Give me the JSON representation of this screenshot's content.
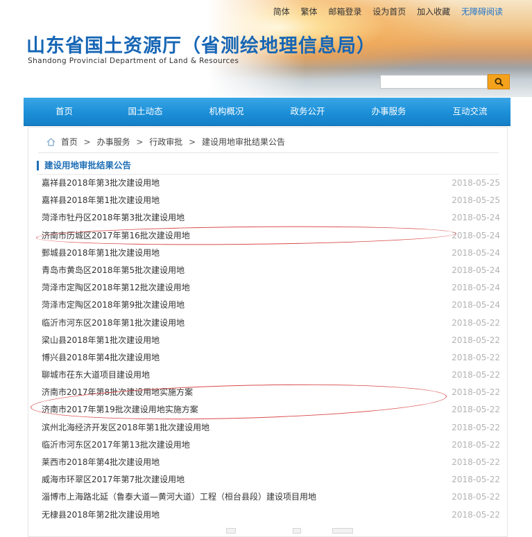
{
  "top_links": {
    "simplified": "简体",
    "traditional": "繁体",
    "mail_login": "邮箱登录",
    "set_homepage": "设为首页",
    "add_favorite": "加入收藏",
    "accessible_read": "无障碍阅读"
  },
  "site": {
    "title": "山东省国土资源厅（省测绘地理信息局）",
    "subtitle": "Shandong Provincial Department of Land & Resources"
  },
  "search": {
    "placeholder": ""
  },
  "nav": {
    "items": [
      {
        "label": "首页"
      },
      {
        "label": "国土动态"
      },
      {
        "label": "机构概况"
      },
      {
        "label": "政务公开"
      },
      {
        "label": "办事服务"
      },
      {
        "label": "互动交流"
      }
    ]
  },
  "breadcrumb": {
    "items": [
      {
        "label": "首页"
      },
      {
        "label": "办事服务"
      },
      {
        "label": "行政审批"
      },
      {
        "label": "建设用地审批结果公告"
      }
    ],
    "separator": ">"
  },
  "section_title": "建设用地审批结果公告",
  "list": [
    {
      "title": "嘉祥县2018年第3批次建设用地",
      "date": "2018-05-25"
    },
    {
      "title": "嘉祥县2018年第1批次建设用地",
      "date": "2018-05-25"
    },
    {
      "title": "菏泽市牡丹区2018年第3批次建设用地",
      "date": "2018-05-24"
    },
    {
      "title": "济南市历城区2017年第16批次建设用地",
      "date": "2018-05-24"
    },
    {
      "title": "鄄城县2018年第1批次建设用地",
      "date": "2018-05-24"
    },
    {
      "title": "青岛市黄岛区2018年第5批次建设用地",
      "date": "2018-05-24"
    },
    {
      "title": "菏泽市定陶区2018年第12批次建设用地",
      "date": "2018-05-24"
    },
    {
      "title": "菏泽市定陶区2018年第9批次建设用地",
      "date": "2018-05-24"
    },
    {
      "title": "临沂市河东区2018年第1批次建设用地",
      "date": "2018-05-22"
    },
    {
      "title": "梁山县2018年第1批次建设用地",
      "date": "2018-05-22"
    },
    {
      "title": "博兴县2018年第4批次建设用地",
      "date": "2018-05-22"
    },
    {
      "title": "聊城市茌东大道项目建设用地",
      "date": "2018-05-22"
    },
    {
      "title": "济南市2017年第8批次建设用地实施方案",
      "date": "2018-05-22"
    },
    {
      "title": "济南市2017年第19批次建设用地实施方案",
      "date": "2018-05-22"
    },
    {
      "title": "滨州北海经济开发区2018年第1批次建设用地",
      "date": "2018-05-22"
    },
    {
      "title": "临沂市河东区2017年第13批次建设用地",
      "date": "2018-05-22"
    },
    {
      "title": "莱西市2018年第4批次建设用地",
      "date": "2018-05-22"
    },
    {
      "title": "威海市环翠区2017年第7批次建设用地",
      "date": "2018-05-22"
    },
    {
      "title": "淄博市上海路北延（鲁泰大道—黄河大道）工程（桓台县段）建设项目用地",
      "date": "2018-05-22"
    },
    {
      "title": "无棣县2018年第2批次建设用地",
      "date": "2018-05-22"
    }
  ],
  "colors": {
    "brand_blue": "#1766b5",
    "nav_blue": "#1b8fd8",
    "search_orange": "#f4a21c",
    "annotation_red": "#d94a4a",
    "date_gray": "#b3b3b3"
  }
}
